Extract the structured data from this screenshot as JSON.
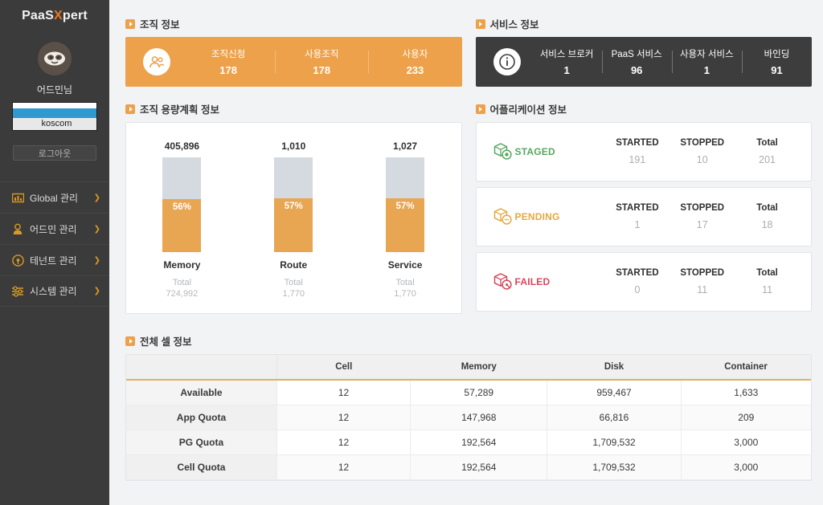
{
  "sidebar": {
    "logo": {
      "part1": "PaaS",
      "x": "X",
      "part2": "pert"
    },
    "username": "어드민님",
    "org_select": {
      "selected": "",
      "options": [
        "",
        "koscom"
      ],
      "visible_option": "koscom"
    },
    "logout_label": "로그아웃",
    "items": [
      {
        "label": "Global 관리",
        "icon": "bar-chart-icon",
        "chevron": "❯"
      },
      {
        "label": "어드민 관리",
        "icon": "lock-user-icon",
        "chevron": "❯"
      },
      {
        "label": "테넌트 관리",
        "icon": "target-icon",
        "chevron": "❯"
      },
      {
        "label": "시스템 관리",
        "icon": "sliders-icon",
        "chevron": "❯"
      }
    ]
  },
  "org_info": {
    "title": "조직 정보",
    "icon": "users-icon",
    "stats": [
      {
        "label": "조직신청",
        "value": "178"
      },
      {
        "label": "사용조직",
        "value": "178"
      },
      {
        "label": "사용자",
        "value": "233"
      }
    ]
  },
  "service_info": {
    "title": "서비스 정보",
    "icon": "info-icon",
    "stats": [
      {
        "label": "서비스 브로커",
        "value": "1"
      },
      {
        "label": "PaaS 서비스",
        "value": "96"
      },
      {
        "label": "사용자 서비스",
        "value": "1"
      },
      {
        "label": "바인딩",
        "value": "91"
      }
    ]
  },
  "capacity": {
    "title": "조직 용량계획 정보",
    "total_label": "Total"
  },
  "app_info": {
    "title": "어플리케이션 정보",
    "cards": [
      {
        "status": "STAGED",
        "color": "#57a860",
        "stats": [
          {
            "label": "STARTED",
            "value": "191"
          },
          {
            "label": "STOPPED",
            "value": "10"
          },
          {
            "label": "Total",
            "value": "201"
          }
        ]
      },
      {
        "status": "PENDING",
        "color": "#e5a83f",
        "stats": [
          {
            "label": "STARTED",
            "value": "1"
          },
          {
            "label": "STOPPED",
            "value": "17"
          },
          {
            "label": "Total",
            "value": "18"
          }
        ]
      },
      {
        "status": "FAILED",
        "color": "#d6485b",
        "stats": [
          {
            "label": "STARTED",
            "value": "0"
          },
          {
            "label": "STOPPED",
            "value": "11"
          },
          {
            "label": "Total",
            "value": "11"
          }
        ]
      }
    ]
  },
  "cell_info": {
    "title": "전체 셀 정보",
    "columns": [
      "",
      "Cell",
      "Memory",
      "Disk",
      "Container"
    ],
    "rows": [
      {
        "name": "Available",
        "cell": "12",
        "memory": "57,289",
        "disk": "959,467",
        "container": "1,633"
      },
      {
        "name": "App Quota",
        "cell": "12",
        "memory": "147,968",
        "disk": "66,816",
        "container": "209"
      },
      {
        "name": "PG Quota",
        "cell": "12",
        "memory": "192,564",
        "disk": "1,709,532",
        "container": "3,000"
      },
      {
        "name": "Cell Quota",
        "cell": "12",
        "memory": "192,564",
        "disk": "1,709,532",
        "container": "3,000"
      }
    ]
  },
  "chart_data": {
    "type": "bar",
    "title": "조직 용량계획 정보",
    "categories": [
      "Memory",
      "Route",
      "Service"
    ],
    "series": [
      {
        "name": "Used",
        "values": [
          405896,
          1010,
          1027
        ]
      },
      {
        "name": "Total",
        "values": [
          724992,
          1770,
          1770
        ]
      }
    ],
    "used_labels": [
      "405,896",
      "1,010",
      "1,027"
    ],
    "total_labels": [
      "724,992",
      "1,770",
      "1,770"
    ],
    "percents": [
      56,
      57,
      57
    ],
    "percent_labels": [
      "56%",
      "57%",
      "57%"
    ],
    "total_caption": "Total",
    "colors": {
      "used": "#e8a552",
      "remaining": "#d5d9e0"
    },
    "grid": false,
    "legend": "none",
    "ylabel": "",
    "xlabel": ""
  },
  "colors": {
    "accent": "#eda14a",
    "sidebar_bg": "#3b3b3b",
    "page_bg": "#f2f3f5",
    "dark_card": "#3d3d3d"
  }
}
